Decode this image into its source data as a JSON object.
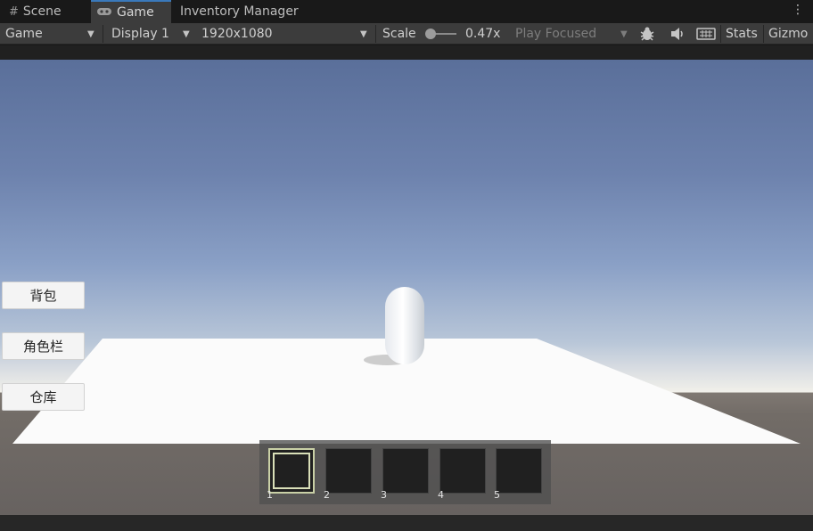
{
  "tabs": [
    {
      "label": "Scene",
      "icon": "grid-icon"
    },
    {
      "label": "Game",
      "icon": "gamepad-icon"
    },
    {
      "label": "Inventory Manager",
      "icon": ""
    }
  ],
  "toolbar": {
    "mode_select": "Game",
    "display_select": "Display 1",
    "resolution_select": "1920x1080",
    "scale_label": "Scale",
    "scale_value": "0.47x",
    "scale_fraction": 0.0,
    "play_mode_select": "Play Focused",
    "stats_label": "Stats",
    "gizmos_label": "Gizmo"
  },
  "game_ui": {
    "buttons": [
      "背包",
      "角色栏",
      "仓库"
    ],
    "hotbar_slots": [
      "1",
      "2",
      "3",
      "4",
      "5"
    ],
    "selected_slot": 1
  },
  "colors": {
    "accent_tab": "#3a79bb",
    "toolbar_bg": "#3c3c3c",
    "hotbar_selected_border": "#c9d0a6"
  }
}
